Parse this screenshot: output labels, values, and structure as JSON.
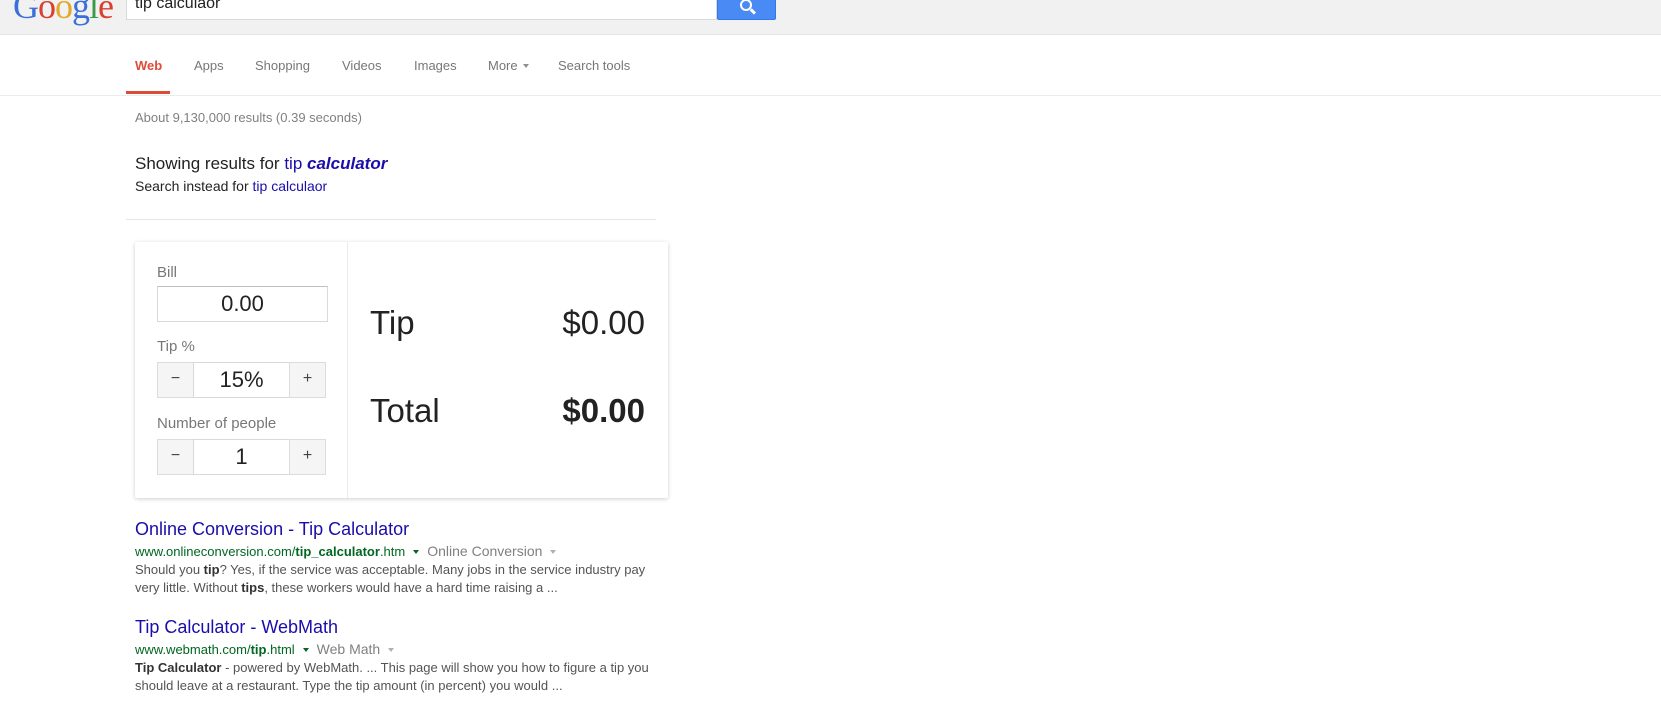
{
  "header": {
    "logo_text": "Google",
    "search_value": "tip calculaor"
  },
  "nav": {
    "tabs": [
      {
        "label": "Web",
        "active": true
      },
      {
        "label": "Apps"
      },
      {
        "label": "Shopping"
      },
      {
        "label": "Videos"
      },
      {
        "label": "Images"
      },
      {
        "label": "More"
      },
      {
        "label": "Search tools"
      }
    ]
  },
  "stats": "About 9,130,000 results (0.39 seconds)",
  "correction": {
    "showing_prefix": "Showing results for",
    "corrected_plain": "tip",
    "corrected_bold": "calculator",
    "instead_prefix": "Search instead for",
    "original_query": "tip calculaor"
  },
  "calculator": {
    "bill_label": "Bill",
    "bill_value": "0.00",
    "tip_label": "Tip %",
    "tip_value": "15%",
    "people_label": "Number of people",
    "people_value": "1",
    "minus": "−",
    "plus": "+",
    "tip_result_label": "Tip",
    "tip_result_value": "$0.00",
    "total_label": "Total",
    "total_value": "$0.00"
  },
  "results": [
    {
      "title": "Online Conversion - Tip Calculator",
      "url_prefix": "www.onlineconversion.com/",
      "url_bold": "tip_calculator",
      "url_suffix": ".htm",
      "site": "Online Conversion",
      "snippet_parts": [
        "Should you ",
        "tip",
        "? Yes, if the service was acceptable. Many jobs in the service industry pay very little. Without ",
        "tips",
        ", these workers would have a hard time raising a ..."
      ]
    },
    {
      "title": "Tip Calculator - WebMath",
      "url_prefix": "www.webmath.com/",
      "url_bold": "tip",
      "url_suffix": ".html",
      "site": "Web Math",
      "snippet_parts": [
        "Tip Calculator",
        " - powered by WebMath. ... This page will show you how to figure a tip you should leave at a restaurant. Type the tip amount (in percent) you would ..."
      ]
    }
  ],
  "colors": {
    "accent_red": "#dd4b39",
    "link_blue": "#1a0dab",
    "url_green": "#006621",
    "search_button": "#4a8af4"
  }
}
